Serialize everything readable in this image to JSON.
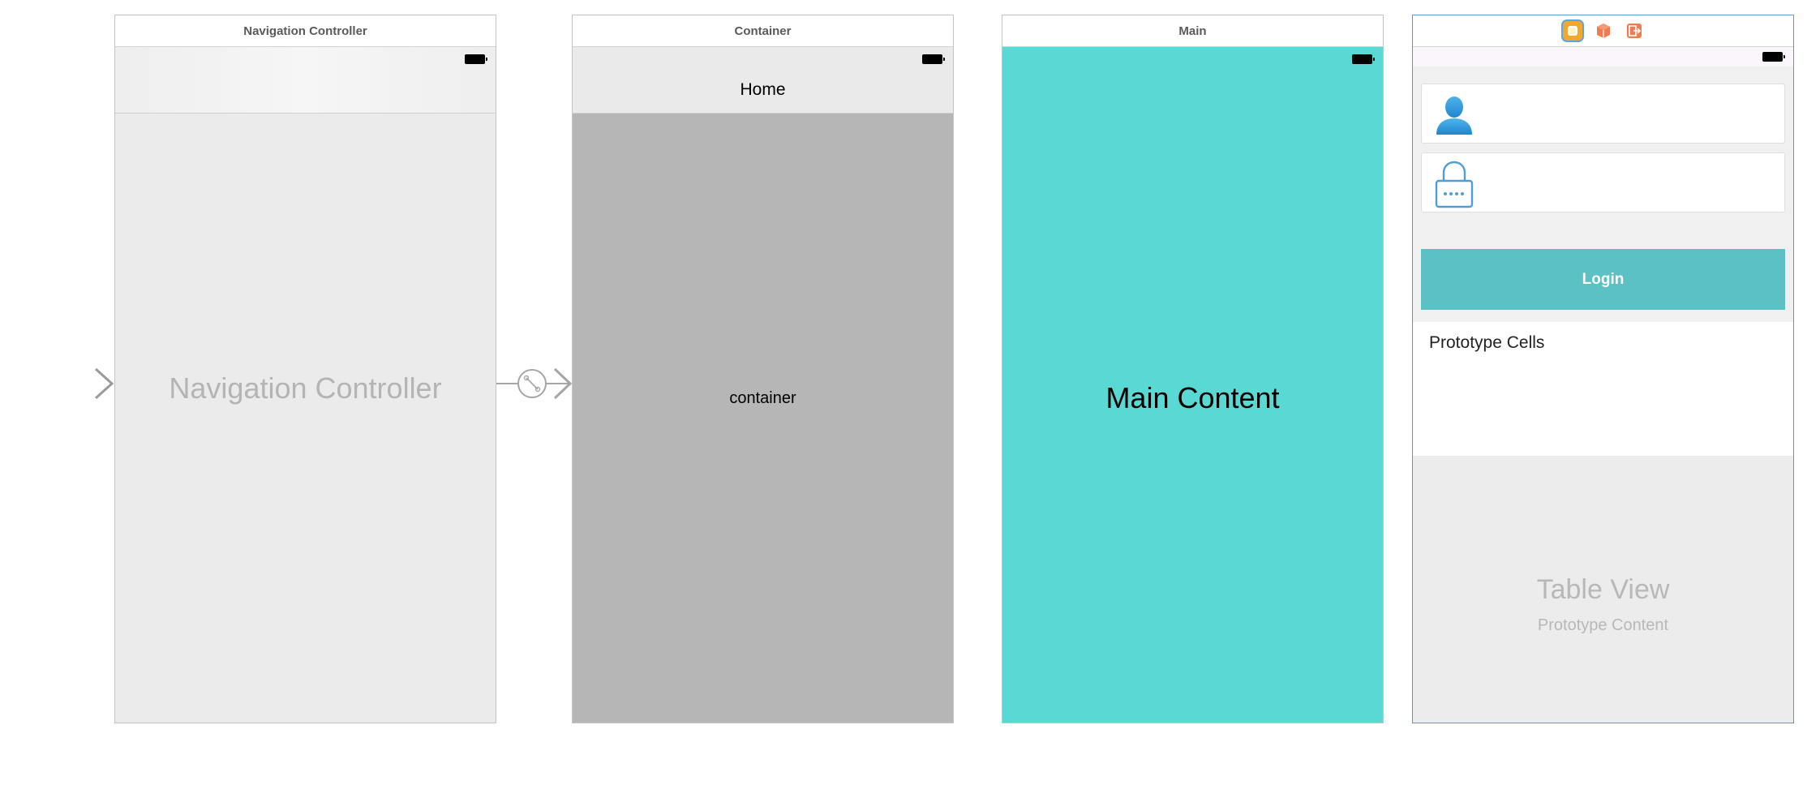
{
  "storyboard": {
    "entry_arrow": "entry-point-arrow",
    "segue_icon": "embed-segue-icon",
    "scenes": {
      "navigation": {
        "title": "Navigation Controller",
        "center_label": "Navigation Controller"
      },
      "container": {
        "title": "Container",
        "nav_title": "Home",
        "center_label": "container"
      },
      "main": {
        "title": "Main",
        "center_label": "Main Content"
      },
      "login": {
        "dock_icons": [
          "view-controller-icon",
          "first-responder-icon",
          "exit-icon"
        ],
        "username_icon": "user-icon",
        "password_icon": "lock-icon",
        "login_label": "Login",
        "prototype_cells_label": "Prototype Cells",
        "table_view_title": "Table View",
        "table_view_subtitle": "Prototype Content"
      }
    }
  },
  "colors": {
    "main_background": "#59d8d4",
    "login_button": "#5bc1c4",
    "container_background": "#b6b6b6",
    "selection_border": "#5a97d6"
  }
}
